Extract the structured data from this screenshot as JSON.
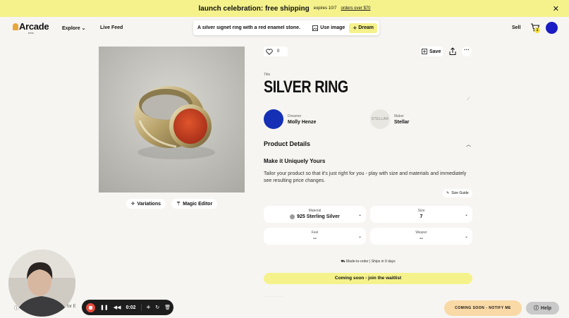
{
  "banner": {
    "main": "launch celebration: free shipping",
    "expires": "expires 10/7",
    "link": "orders over $70"
  },
  "nav": {
    "logo": "Arcade",
    "logo_badge": "beta",
    "explore": "Explore",
    "live_feed": "Live Feed",
    "search_query": "A silver signet ring with a red enamel stone.",
    "use_image": "Use image",
    "dream": "Dream",
    "sell": "Sell",
    "cart_count": "1"
  },
  "product": {
    "likes": "0",
    "save": "Save",
    "title_label": "Title",
    "title": "SILVER RING",
    "dreamer_role": "Dreamer",
    "dreamer_name": "Molly Henze",
    "maker_role": "Maker",
    "maker_name": "Stellar",
    "maker_logo": "STELLAR",
    "variations": "Variations",
    "magic_editor": "Magic Editor"
  },
  "details": {
    "section_title": "Product Details",
    "heading": "Make it Uniquely Yours",
    "description": "Tailor your product so that it's just right for you - play with size and materials and immediately see resulting price changes.",
    "size_guide": "Size Guide",
    "options": [
      {
        "label": "Material",
        "value": "925 Sterling Silver"
      },
      {
        "label": "Size",
        "value": "7"
      },
      {
        "label": "Feel",
        "value": "--"
      },
      {
        "label": "Wearer",
        "value": "--"
      }
    ],
    "shipping": "Made-to-order | Ships in 9 days",
    "waitlist": "Coming soon - join the waitlist",
    "notify": "COMING SOON - NOTIFY ME",
    "help": "Help"
  },
  "recorder": {
    "time": "0:02",
    "partial_text": "o for E"
  },
  "colors": {
    "accent_yellow": "#f5f28c",
    "avatar_blue": "#1c1cc4",
    "record_red": "#e94b3c"
  }
}
